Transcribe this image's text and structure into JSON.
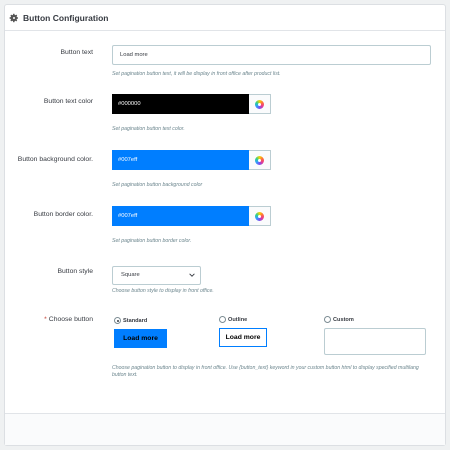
{
  "panel": {
    "title": "Button Configuration"
  },
  "fields": {
    "button_text": {
      "label": "Button text",
      "value": "Load more",
      "help": "Set pagination button text, it will be display in front office after product list."
    },
    "text_color": {
      "label": "Button text color",
      "value": "#000000",
      "help": "Set pagination button text color."
    },
    "bg_color": {
      "label": "Button background color.",
      "value": "#007eff",
      "help": "Set pagination button background color"
    },
    "border_color": {
      "label": "Button border color.",
      "value": "#007eff",
      "help": "Set pagination button border color."
    },
    "button_style": {
      "label": "Button style",
      "selected": "Square",
      "help": "Choose button style to display in front office."
    },
    "choose_button": {
      "required_mark": "*",
      "label": "Choose button",
      "options": [
        {
          "label": "Standard",
          "checked": true,
          "preview": "Load more"
        },
        {
          "label": "Outline",
          "checked": false,
          "preview": "Load more"
        },
        {
          "label": "Custom",
          "checked": false,
          "preview": ""
        }
      ],
      "help": "Choose pagination button to display in front office. Use {button_text} keyword in your custom button html to display specified multilang button text."
    }
  },
  "colors": {
    "black": "#000000",
    "blue": "#007eff"
  },
  "icons": {
    "panel_icon": "gear-icon",
    "color_picker": "color-wheel-icon",
    "select_arrow": "chevron-down-icon"
  }
}
